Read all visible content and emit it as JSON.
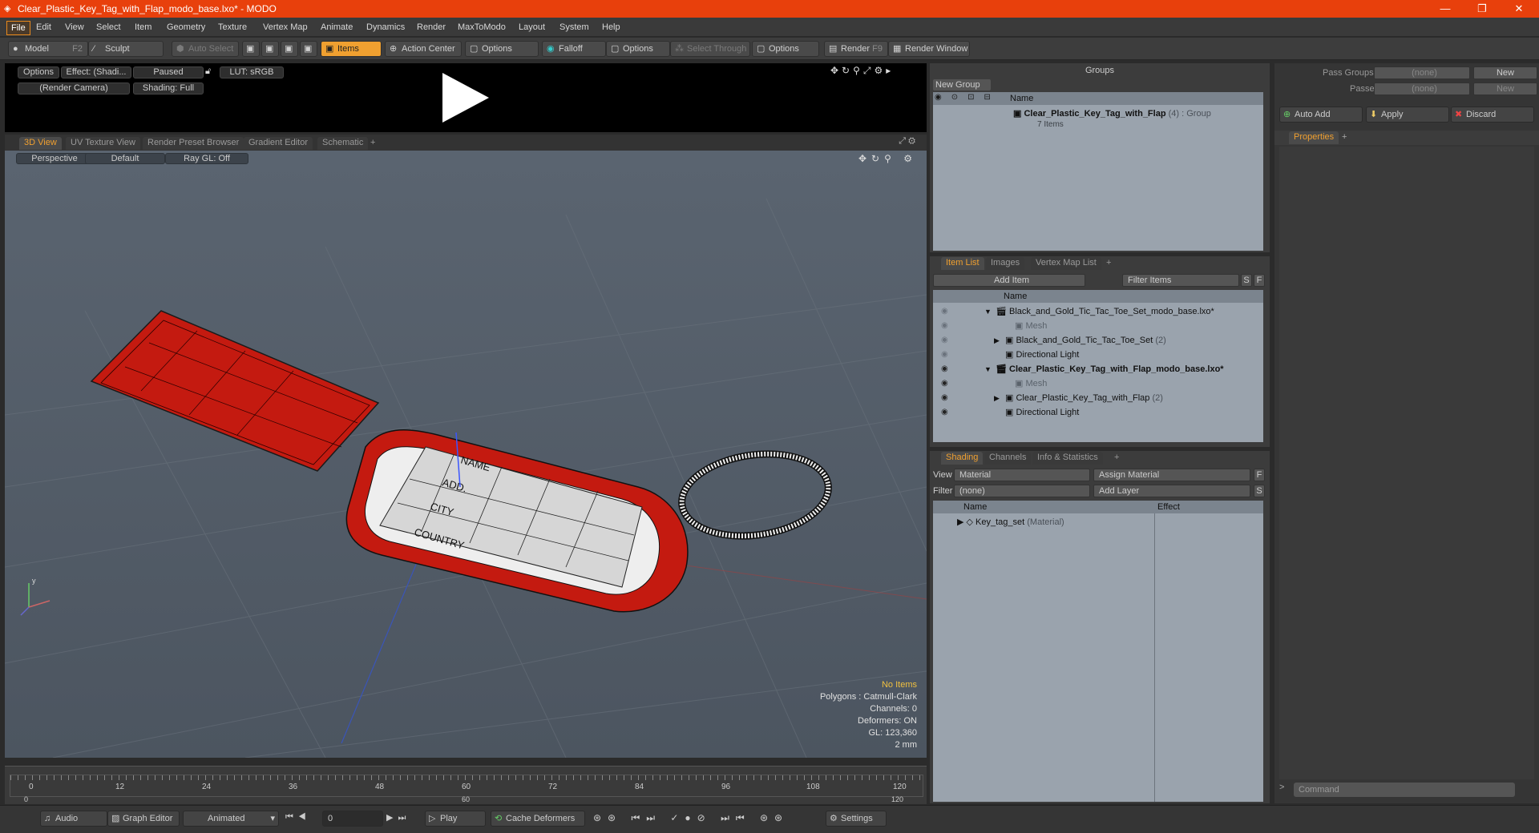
{
  "window": {
    "title": "Clear_Plastic_Key_Tag_with_Flap_modo_base.lxo* - MODO",
    "minimize": "—",
    "restore": "❐",
    "close": "✕"
  },
  "menu": [
    "File",
    "Edit",
    "View",
    "Select",
    "Item",
    "Geometry",
    "Texture",
    "Vertex Map",
    "Animate",
    "Dynamics",
    "Render",
    "MaxToModo",
    "Layout",
    "System",
    "Help"
  ],
  "toolbar": {
    "model": "Model",
    "model_key": "F2",
    "sculpt": "Sculpt",
    "auto_select": "Auto Select",
    "items": "Items",
    "action_center": "Action Center",
    "options1": "Options",
    "falloff": "Falloff",
    "options2": "Options",
    "select_through": "Select Through",
    "options3": "Options",
    "render": "Render",
    "render_key": "F9",
    "render_window": "Render Window"
  },
  "preview": {
    "options": "Options",
    "effect": "Effect: (Shadi...",
    "paused": "Paused",
    "lut": "LUT: sRGB",
    "camera": "(Render Camera)",
    "shading": "Shading: Full"
  },
  "viewtabs": [
    "3D View",
    "UV Texture View",
    "Render Preset Browser",
    "Gradient Editor",
    "Schematic",
    "+"
  ],
  "viewport": {
    "perspective": "Perspective",
    "default": "Default",
    "raygl": "Ray GL: Off",
    "stats": {
      "no_items": "No Items",
      "polygons": "Polygons : Catmull-Clark",
      "channels": "Channels: 0",
      "deformers": "Deformers: ON",
      "gl": "GL: 123,360",
      "scale": "2 mm"
    },
    "tag_labels": [
      "NAME",
      "ADD.",
      "CITY",
      "COUNTRY"
    ]
  },
  "timeline": {
    "ticks": [
      "0",
      "12",
      "24",
      "36",
      "48",
      "60",
      "72",
      "84",
      "96",
      "108",
      "120"
    ],
    "sub_ticks": [
      "0",
      "60",
      "120"
    ]
  },
  "bottombar": {
    "audio": "Audio",
    "graph_editor": "Graph Editor",
    "animated": "Animated",
    "frame": "0",
    "play": "Play",
    "cache_deformers": "Cache Deformers",
    "settings": "Settings"
  },
  "groups": {
    "title": "Groups",
    "new_group": "New Group",
    "col_name": "Name",
    "item_name": "Clear_Plastic_Key_Tag_with_Flap",
    "item_count": "(4)",
    "item_type": ": Group",
    "item_sub": "7 Items"
  },
  "itemlist": {
    "tabs": [
      "Item List",
      "Images",
      "Vertex Map List",
      "+"
    ],
    "add_item": "Add Item",
    "filter": "Filter Items",
    "s": "S",
    "f": "F",
    "col_name": "Name",
    "rows": [
      {
        "label": "Black_and_Gold_Tic_Tac_Toe_Set_modo_base.lxo*",
        "indent": 0,
        "expander": "▼",
        "eye": false,
        "bold": false,
        "dim": false
      },
      {
        "label": "Mesh",
        "indent": 2,
        "expander": "",
        "eye": false,
        "bold": false,
        "dim": true
      },
      {
        "label": "Black_and_Gold_Tic_Tac_Toe_Set",
        "suffix": "(2)",
        "indent": 1,
        "expander": "▶",
        "eye": false,
        "bold": false,
        "dim": false
      },
      {
        "label": "Directional Light",
        "indent": 1,
        "expander": "",
        "eye": false,
        "bold": false,
        "dim": false
      },
      {
        "label": "Clear_Plastic_Key_Tag_with_Flap_modo_base.lxo*",
        "indent": 0,
        "expander": "▼",
        "eye": true,
        "bold": true,
        "dim": false
      },
      {
        "label": "Mesh",
        "indent": 2,
        "expander": "",
        "eye": true,
        "bold": false,
        "dim": true
      },
      {
        "label": "Clear_Plastic_Key_Tag_with_Flap",
        "suffix": "(2)",
        "indent": 1,
        "expander": "▶",
        "eye": true,
        "bold": false,
        "dim": false
      },
      {
        "label": "Directional Light",
        "indent": 1,
        "expander": "",
        "eye": true,
        "bold": false,
        "dim": false
      }
    ]
  },
  "shading": {
    "tabs": [
      "Shading",
      "Channels",
      "Info & Statistics",
      "+"
    ],
    "view_label": "View",
    "view_value": "Material",
    "assign": "Assign Material",
    "filter_label": "Filter",
    "filter_value": "(none)",
    "add_layer": "Add Layer",
    "f": "F",
    "s": "S",
    "col_name": "Name",
    "col_effect": "Effect",
    "row_name": "Key_tag_set",
    "row_type": "(Material)"
  },
  "right": {
    "pass_groups": "Pass Groups",
    "pass_groups_val": "(none)",
    "passes": "Passes",
    "passes_val": "(none)",
    "new1": "New",
    "new2": "New",
    "auto_add": "Auto Add",
    "apply": "Apply",
    "discard": "Discard",
    "properties": "Properties",
    "command": "Command"
  },
  "colors": {
    "accent": "#f0a030",
    "title": "#e8400c",
    "mesh_red": "#c41a10"
  }
}
